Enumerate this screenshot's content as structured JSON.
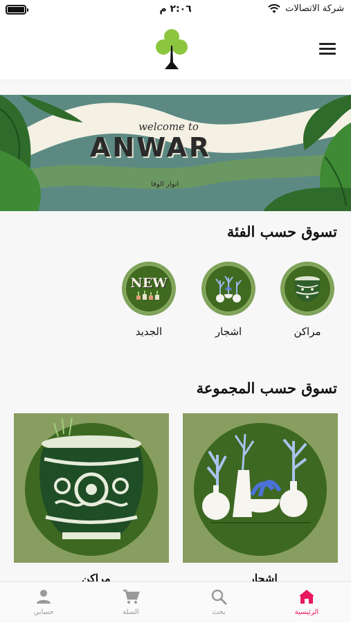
{
  "status_bar": {
    "time": "٢:٠٦ م",
    "carrier": "شركة الاتصالات"
  },
  "banner": {
    "small_text": "welcome to",
    "title": "ANWAR",
    "subtitle": "انوار الوفا"
  },
  "category_section": {
    "title": "تسوق حسب الفئة",
    "items": [
      {
        "label": "مراكن",
        "icon": "planter-pot-icon"
      },
      {
        "label": "اشجار",
        "icon": "plants-vases-icon"
      },
      {
        "label": "الجديد",
        "icon": "new-badge-icon",
        "badge_text": "NEW"
      }
    ]
  },
  "collection_section": {
    "title": "تسوق حسب المجموعة",
    "cards": [
      {
        "label": "اشجار",
        "icon": "plants-vases-icon"
      },
      {
        "label": "مراكن",
        "icon": "planter-pot-icon"
      }
    ]
  },
  "tab_bar": {
    "tabs": [
      {
        "label": "الرئيسية",
        "icon": "home-icon",
        "active": true
      },
      {
        "label": "بحث",
        "icon": "search-icon"
      },
      {
        "label": "السلة",
        "icon": "cart-icon"
      },
      {
        "label": "حسابي",
        "icon": "user-icon"
      }
    ],
    "active_color": "#e8195e"
  },
  "colors": {
    "brand_green": "#8cc63f",
    "card_green": "#889e61",
    "disc_green": "#3d6821"
  }
}
